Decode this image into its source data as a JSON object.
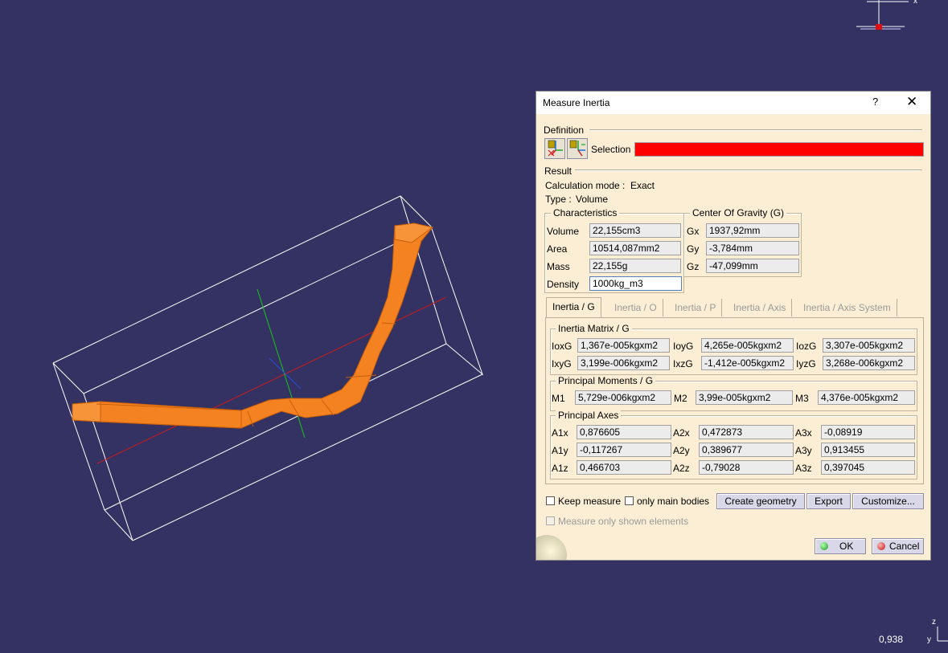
{
  "viewport": {
    "scale_readout": "0,938",
    "compass_x": "x",
    "compass_y": "y",
    "compass_z": "z"
  },
  "dialog": {
    "title": "Measure Inertia",
    "help": "?",
    "close": "✕",
    "definition": {
      "label": "Definition",
      "selection_label": "Selection :",
      "selection_color": "#ff0000"
    },
    "result": {
      "label": "Result",
      "calc_mode_label": "Calculation mode :",
      "calc_mode_value": "Exact",
      "type_label": "Type :",
      "type_value": "Volume"
    },
    "characteristics": {
      "title": "Characteristics",
      "volume_label": "Volume",
      "volume": "22,155cm3",
      "area_label": "Area",
      "area": "10514,087mm2",
      "mass_label": "Mass",
      "mass": "22,155g",
      "density_label": "Density",
      "density": "1000kg_m3"
    },
    "cog": {
      "title": "Center Of Gravity (G)",
      "gx_label": "Gx",
      "gx": "1937,92mm",
      "gy_label": "Gy",
      "gy": "-3,784mm",
      "gz_label": "Gz",
      "gz": "-47,099mm"
    },
    "tabs": [
      "Inertia / G",
      "Inertia / O",
      "Inertia / P",
      "Inertia / Axis",
      "Inertia / Axis System"
    ],
    "inertia_matrix": {
      "title": "Inertia Matrix / G",
      "IoxG_label": "IoxG",
      "IoxG": "1,367e-005kgxm2",
      "IoyG_label": "IoyG",
      "IoyG": "4,265e-005kgxm2",
      "IozG_label": "IozG",
      "IozG": "3,307e-005kgxm2",
      "IxyG_label": "IxyG",
      "IxyG": "3,199e-006kgxm2",
      "IxzG_label": "IxzG",
      "IxzG": "-1,412e-005kgxm2",
      "IyzG_label": "IyzG",
      "IyzG": "3,268e-006kgxm2"
    },
    "principal_moments": {
      "title": "Principal Moments / G",
      "M1_label": "M1",
      "M1": "5,729e-006kgxm2",
      "M2_label": "M2",
      "M2": "3,99e-005kgxm2",
      "M3_label": "M3",
      "M3": "4,376e-005kgxm2"
    },
    "principal_axes": {
      "title": "Principal Axes",
      "A1x_label": "A1x",
      "A1x": "0,876605",
      "A2x_label": "A2x",
      "A2x": "0,472873",
      "A3x_label": "A3x",
      "A3x": "-0,08919",
      "A1y_label": "A1y",
      "A1y": "-0,117267",
      "A2y_label": "A2y",
      "A2y": "0,389677",
      "A3y_label": "A3y",
      "A3y": "0,913455",
      "A1z_label": "A1z",
      "A1z": "0,466703",
      "A2z_label": "A2z",
      "A2z": "-0,79028",
      "A3z_label": "A3z",
      "A3z": "0,397045"
    },
    "options": {
      "keep_measure": "Keep measure",
      "only_main_bodies": "only main bodies",
      "measure_only_shown": "Measure only shown elements"
    },
    "buttons": {
      "create_geometry": "Create geometry",
      "export": "Export",
      "customize": "Customize...",
      "ok": "OK",
      "cancel": "Cancel"
    },
    "colors": {
      "part": "#f58220",
      "dialog_bg": "#fbeed5",
      "viewport_bg": "#333263"
    }
  }
}
